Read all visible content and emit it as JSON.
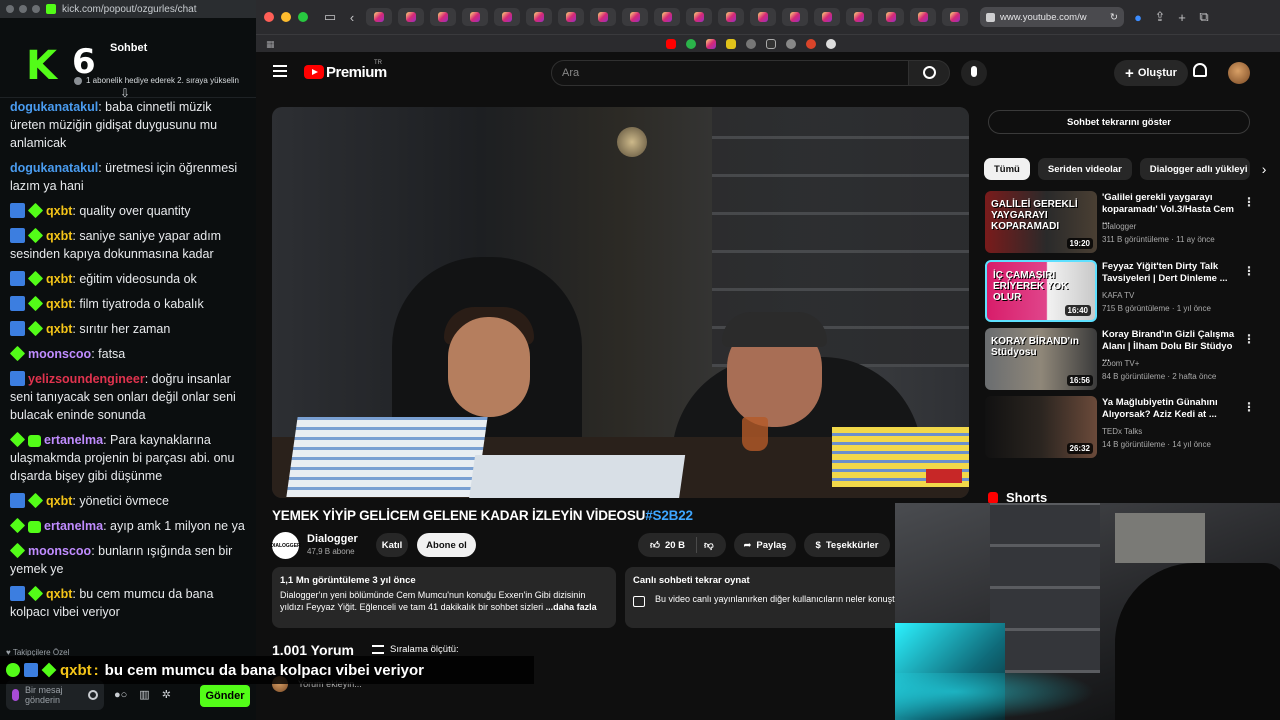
{
  "kick": {
    "url": "kick.com/popout/ozgurles/chat",
    "title": "Sohbet",
    "logo_letter": "K",
    "rank_number": "6",
    "pinned_text": "1 abonelik hediye ederek 2. sıraya yükselin",
    "followers_label": "Takipçilere Özel",
    "input_placeholder": "Bir mesaj gönderin",
    "send_label": "Gönder",
    "messages": [
      {
        "user": "dogukanatakul",
        "color": "#4a9cf0",
        "text": "baba cinnetli müzik üreten müziğin gidişat duygusunu mu anlamicak",
        "badges": []
      },
      {
        "user": "dogukanatakul",
        "color": "#4a9cf0",
        "text": "üretmesi için öğrenmesi lazım ya hani",
        "badges": []
      },
      {
        "user": "qxbt",
        "color": "#f5c518",
        "text": "quality over quantity",
        "badges": [
          "blue",
          "green"
        ]
      },
      {
        "user": "qxbt",
        "color": "#f5c518",
        "text": "saniye saniye yapar adım sesinden kapıya dokunmasına kadar",
        "badges": [
          "blue",
          "green"
        ]
      },
      {
        "user": "qxbt",
        "color": "#f5c518",
        "text": "eğitim videosunda ok",
        "badges": [
          "blue",
          "green"
        ]
      },
      {
        "user": "qxbt",
        "color": "#f5c518",
        "text": "film tiyatroda o kabalık",
        "badges": [
          "blue",
          "green"
        ]
      },
      {
        "user": "qxbt",
        "color": "#f5c518",
        "text": "sırıtır her zaman",
        "badges": [
          "blue",
          "green"
        ]
      },
      {
        "user": "moonscoo",
        "color": "#c08cff",
        "text": "fatsa",
        "badges": [
          "green"
        ]
      },
      {
        "user": "yelizsoundengineer",
        "color": "#e0334e",
        "text": "doğru insanlar seni tanıyacak sen onları değil onlar seni bulacak eninde sonunda",
        "badges": [
          "blue"
        ]
      },
      {
        "user": "ertanelma",
        "color": "#c08cff",
        "text": "Para kaynaklarına ulaşmakmda projenin bi parçası abi. onu dışarda bişey gibi düşünme",
        "badges": [
          "green",
          "gift"
        ]
      },
      {
        "user": "qxbt",
        "color": "#f5c518",
        "text": "yönetici övmece",
        "badges": [
          "blue",
          "green"
        ]
      },
      {
        "user": "ertanelma",
        "color": "#c08cff",
        "text": "ayıp amk 1 milyon ne ya",
        "badges": [
          "green",
          "gift"
        ]
      },
      {
        "user": "moonscoo",
        "color": "#c08cff",
        "text": "bunların ışığında sen bir yemek ye",
        "badges": [
          "green"
        ]
      },
      {
        "user": "qxbt",
        "color": "#f5c518",
        "text": "bu cem mumcu da bana kolpacı vibei veriyor",
        "badges": [
          "blue",
          "green"
        ]
      }
    ]
  },
  "overlay": {
    "user": "qxbt",
    "separator": ":",
    "text": "bu cem mumcu da bana kolpacı vibei veriyor"
  },
  "browser": {
    "url": "www.youtube.com/w"
  },
  "youtube": {
    "brand": "Premium",
    "region": "TR",
    "search_placeholder": "Ara",
    "create_label": "Oluştur",
    "video_title": "YEMEK YİYİP GELİCEM GELENE KADAR İZLEYİN VİDEOSU",
    "video_hashtag": "#S2B22",
    "channel_name": "Dialogger",
    "channel_logo_text": "DIALOGGER",
    "channel_subs": "47,9 B abone",
    "join_label": "Katıl",
    "subscribe_label": "Abone ol",
    "like_count": "20 B",
    "share_label": "Paylaş",
    "thanks_label": "Teşekkürler",
    "desc_stats": "1,1 Mn görüntüleme  3 yıl önce",
    "desc_text": "Dialogger'ın yeni bölümünde Cem Mumcu'nun konuğu Exxen'in Gibi dizisinin yıldızı Feyyaz Yiğit. Eğlenceli ve tam 41 dakikalık bir sohbet sizleri",
    "desc_more": "...daha fazla",
    "replay_title": "Canlı sohbeti tekrar oynat",
    "replay_text": "Bu video canlı yayınlanırken diğer kullanıcıların neler konuştuğunu görün.",
    "comments_count": "1.001 Yorum",
    "sort_label": "Sıralama ölçütü:",
    "add_comment": "Yorum ekleyin...",
    "show_chat_replay": "Sohbet tekrarını göster",
    "chips": [
      "Tümü",
      "Seriden videolar",
      "Dialogger adlı yükleyi"
    ],
    "recommendations": [
      {
        "title": "'Galilei gerekli yaygarayı koparamadı' Vol.3/Hasta Cem ...",
        "channel": "Dialogger",
        "meta": "311 B görüntüleme · 11 ay önce",
        "duration": "19:20",
        "thumb_text": "GALİLEİ GEREKLİ YAYGARAYI KOPARAMADI"
      },
      {
        "title": "Feyyaz Yiğit'ten Dirty Talk Tavsiyeleri | Dert Dinleme ...",
        "channel": "KAFA TV",
        "meta": "715 B görüntüleme · 1 yıl önce",
        "duration": "16:40",
        "thumb_text": "İÇ ÇAMAŞIRI ERİYEREK YOK OLUR"
      },
      {
        "title": "Koray Birand'ın Gizli Çalışma Alanı | İlham Dolu Bir Stüdyo ...",
        "channel": "Zoom TV+",
        "meta": "84 B görüntüleme · 2 hafta önce",
        "duration": "16:56",
        "thumb_text": "KORAY BİRAND'ın Stüdyosu"
      },
      {
        "title": "Ya Mağlubiyetin Günahını Alıyorsak? Aziz Kedi at ...",
        "channel": "TEDx Talks",
        "meta": "14 B görüntüleme · 14 yıl önce",
        "duration": "26:32",
        "thumb_text": ""
      }
    ],
    "shorts_label": "Shorts"
  }
}
